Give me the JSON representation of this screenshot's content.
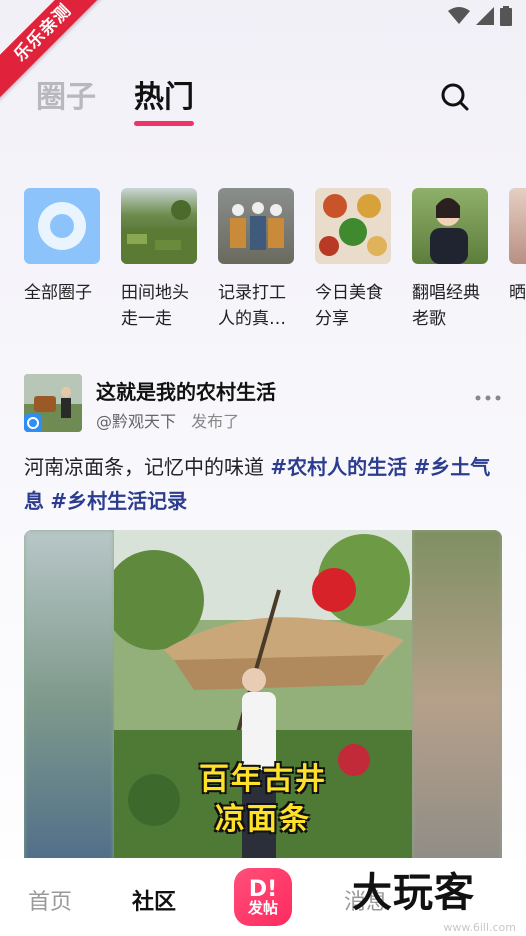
{
  "corner_badge": "乐乐亲测",
  "top_tabs": [
    {
      "label": "圈子",
      "active": false
    },
    {
      "label": "热门",
      "active": true
    }
  ],
  "chips": [
    {
      "label": "全部圈子"
    },
    {
      "label": "田间地头走一走"
    },
    {
      "label": "记录打工人的真…"
    },
    {
      "label": "今日美食分享"
    },
    {
      "label": "翻唱经典老歌"
    },
    {
      "label": "晒孩"
    }
  ],
  "post": {
    "title": "这就是我的农村生活",
    "author": "@黔观天下",
    "action": "发布了",
    "text": "河南凉面条，记忆中的味道 ",
    "tags": [
      "#农村人的生活",
      "#乡土气息",
      "#乡村生活记录"
    ],
    "media_caption_line1": "百年古井",
    "media_caption_line2": "凉面条"
  },
  "bottom_nav": [
    {
      "label": "首页",
      "active": false
    },
    {
      "label": "社区",
      "active": true
    },
    {
      "label": "消息",
      "active": false
    }
  ],
  "fab_label": "发帖",
  "watermark": {
    "brand": "大玩客",
    "url": "www.6ill.com"
  },
  "colors": {
    "accent": "#f0326b",
    "tag": "#2c3d8f",
    "chip_circle_bg": "#7fb8f5"
  }
}
